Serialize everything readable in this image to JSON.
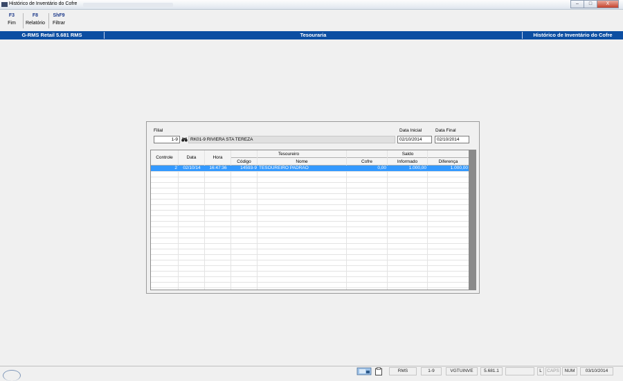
{
  "window": {
    "title": "Histórico de Inventário do Cofre",
    "controls": {
      "minimize": "–",
      "maximize": "□",
      "close": "X"
    }
  },
  "toolbar": {
    "items": [
      {
        "key": "F3",
        "label": "Fim"
      },
      {
        "key": "F8",
        "label": "Relatório"
      },
      {
        "key": "ShF9",
        "label": "Filtrar"
      }
    ]
  },
  "header_bar": {
    "left": "G-RMS Retail 5.681 RMS",
    "center": "Tesouraria",
    "right": "Histórico de Inventário do Cofre"
  },
  "filters": {
    "filial_label": "Filial",
    "filial_code": "1-9",
    "filial_name": "RK01-9 RIVIERA STA TEREZA",
    "data_inicial_label": "Data Inicial",
    "data_inicial": "02/10/2014",
    "data_final_label": "Data Final",
    "data_final": "02/10/2014"
  },
  "grid": {
    "headers": {
      "controle": "Controle",
      "data": "Data",
      "hora": "Hora",
      "tesoureiro": "Tesoureiro",
      "codigo": "Código",
      "nome": "Nome",
      "saldo": "Saldo",
      "cofre": "Cofre",
      "informado": "Informado",
      "diferenca": "Diferença"
    },
    "rows": [
      {
        "controle": "2",
        "data": "02/10/14",
        "hora": "16:47:36",
        "codigo": "14593-9",
        "nome": "TESOUREIRO PADRAO",
        "cofre": "0,00",
        "informado": "1.000,00",
        "diferenca": "1.000,00"
      }
    ]
  },
  "statusbar": {
    "system": "RMS",
    "filial": "1-9",
    "program": "VGTUINVE",
    "version": "5.681.1",
    "l": "L",
    "caps": "CAPS",
    "num": "NUM",
    "date": "03/10/2014"
  }
}
